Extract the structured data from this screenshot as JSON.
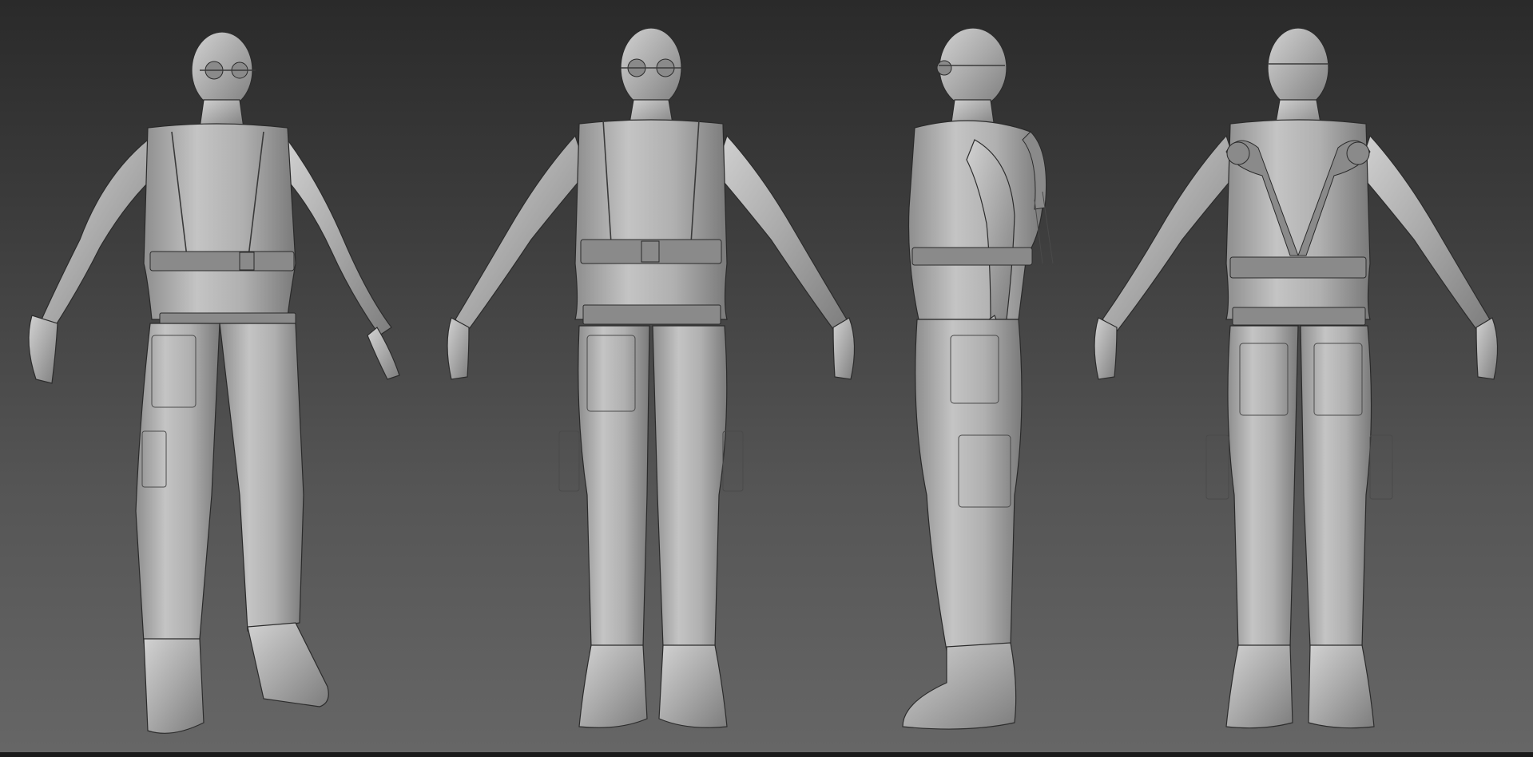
{
  "scene": {
    "background_top": "#2a2a2a",
    "background_bottom": "#666666",
    "material_color": "#b4b4b4",
    "views": [
      {
        "name": "three-quarter-front",
        "icon": "character-3q-view"
      },
      {
        "name": "front",
        "icon": "character-front-view"
      },
      {
        "name": "side",
        "icon": "character-side-view"
      },
      {
        "name": "back",
        "icon": "character-back-view"
      }
    ]
  }
}
